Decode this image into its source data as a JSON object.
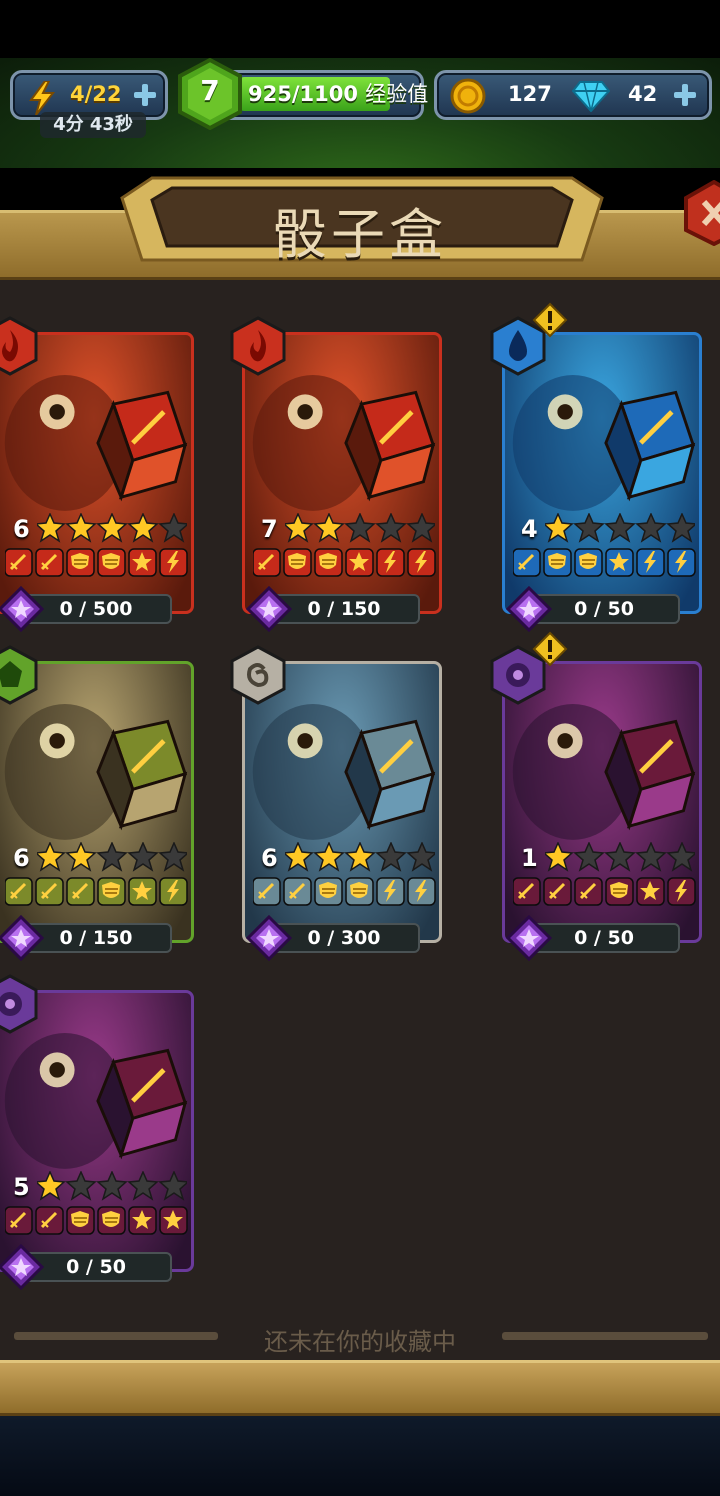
{
  "hud": {
    "energy": "4/22",
    "energy_timer": "4分 43秒",
    "level": "7",
    "xp": "925/1100",
    "xp_label": "经验值",
    "coins": "127",
    "gems": "42"
  },
  "title": "骰子盒",
  "footer_text": "还未在你的收藏中",
  "colors": {
    "fire": "#c9301e",
    "water": "#2a7fd0",
    "earth": "#62a32a",
    "neutral": "#b6b0a4",
    "arcane": "#6a3a9a"
  },
  "cards": [
    {
      "level": "6",
      "stars": 4,
      "progress": "0 / 500",
      "element": "fire",
      "faces": [
        "sword",
        "sword",
        "shield",
        "shield",
        "star",
        "bolt"
      ]
    },
    {
      "level": "7",
      "stars": 2,
      "progress": "0 / 150",
      "element": "fire",
      "faces": [
        "sword",
        "shield",
        "shield",
        "star",
        "bolt",
        "bolt"
      ]
    },
    {
      "level": "4",
      "stars": 1,
      "progress": "0 / 50",
      "element": "water",
      "alert": true,
      "faces": [
        "sword",
        "shield",
        "shield",
        "star",
        "bolt",
        "bolt"
      ]
    },
    {
      "level": "6",
      "stars": 2,
      "progress": "0 / 150",
      "element": "earth",
      "faces": [
        "sword",
        "sword",
        "sword",
        "shield",
        "star",
        "bolt"
      ]
    },
    {
      "level": "6",
      "stars": 3,
      "progress": "0 / 300",
      "element": "neutral",
      "faces": [
        "sword",
        "sword",
        "shield",
        "shield",
        "bolt",
        "bolt"
      ]
    },
    {
      "level": "1",
      "stars": 1,
      "progress": "0 / 50",
      "element": "arcane",
      "alert": true,
      "faces": [
        "sword",
        "sword",
        "sword",
        "shield",
        "star",
        "bolt"
      ]
    },
    {
      "level": "5",
      "stars": 1,
      "progress": "0 / 50",
      "element": "arcane",
      "faces": [
        "sword",
        "sword",
        "shield",
        "shield",
        "star",
        "star"
      ]
    }
  ]
}
